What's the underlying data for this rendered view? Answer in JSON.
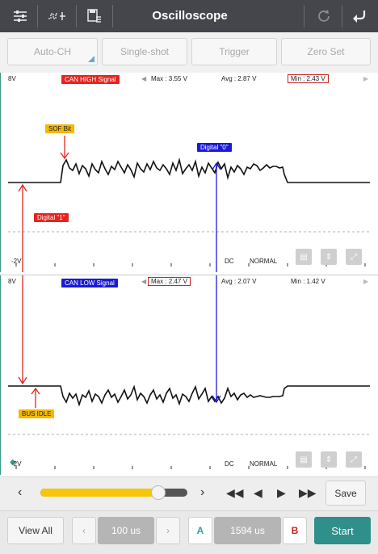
{
  "app": {
    "title": "Oscilloscope"
  },
  "modes": {
    "auto_ch": "Auto-CH",
    "single_shot": "Single-shot",
    "trigger": "Trigger",
    "zero_set": "Zero Set"
  },
  "ch1": {
    "top_scale": "8V",
    "bottom_scale": "-2V",
    "signal": "CAN HIGH Signal",
    "max": "Max : 3.55 V",
    "avg": "Avg : 2.87 V",
    "min": "Min : 2.43 V",
    "coupling": "DC",
    "mode": "NORMAL",
    "signal_color": "#e52420"
  },
  "ch2": {
    "top_scale": "8V",
    "bottom_scale": "-2V",
    "signal": "CAN LOW Signal",
    "max": "Max : 2.47 V",
    "avg": "Avg : 2.07 V",
    "min": "Min : 1.42 V",
    "coupling": "DC",
    "mode": "NORMAL",
    "signal_color": "#1a1ad8"
  },
  "annotations": {
    "sof": "SOF Bit",
    "digital0": "Digital \"0\"",
    "digital1": "Digital \"1\"",
    "bus_idle": "BUS IDLE"
  },
  "timeline": {
    "slider_level": 0.8,
    "save": "Save"
  },
  "bottom": {
    "view_all": "View All",
    "time_div": "100 us",
    "cursor_a": "A",
    "delta": "1594 us",
    "cursor_b": "B",
    "start": "Start"
  },
  "colors": {
    "accent": "#2f8f8a",
    "slider": "#f6c60a",
    "topbar": "#44464c"
  }
}
